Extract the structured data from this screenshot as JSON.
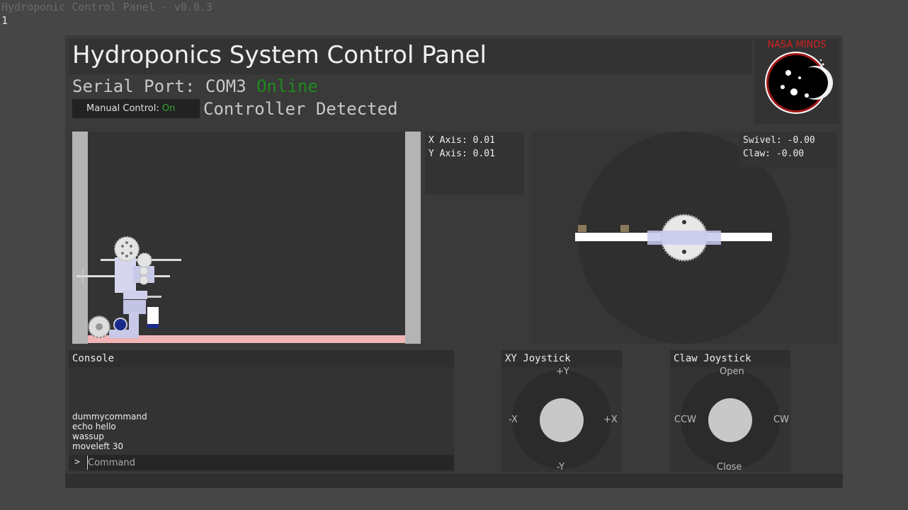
{
  "window": {
    "title": "Hydroponic Control Panel - v0.0.3",
    "frame_index": "1"
  },
  "header": {
    "title": "Hydroponics System Control Panel",
    "serial_label": "Serial Port: COM3",
    "serial_status": "Online",
    "manual_label": "Manual Control:",
    "manual_value": "On",
    "controller_status": "Controller Detected",
    "logo_text": "NASA MINDS"
  },
  "readouts": {
    "x_axis": "X Axis: 0.01",
    "y_axis": "Y Axis: 0.01",
    "swivel": "Swivel: -0.00",
    "claw": "Claw: -0.00"
  },
  "console": {
    "title": "Console",
    "lines": [
      "dummycommand",
      "echo hello",
      "wassup",
      "moveleft 30"
    ],
    "prompt": ">",
    "placeholder": "Command"
  },
  "joysticks": {
    "xy": {
      "title": "XY Joystick",
      "up": "+Y",
      "down": "-Y",
      "left": "-X",
      "right": "+X"
    },
    "claw": {
      "title": "Claw Joystick",
      "up": "Open",
      "down": "Close",
      "left": "CCW",
      "right": "CW"
    }
  },
  "colors": {
    "online": "#1f8a1f",
    "manual_on": "#2ea82e",
    "logo_red": "#d32020",
    "water": "#f0b4b4"
  }
}
